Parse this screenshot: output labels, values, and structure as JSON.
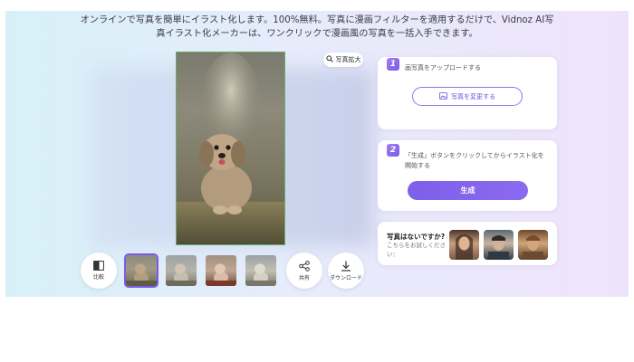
{
  "description": "オンラインで写真を簡単にイラスト化します。100%無料。写真に漫画フィルターを適用するだけで、Vidnoz AI写真イラスト化メーカーは、ワンクリックで漫画風の写真を一括入手できます。",
  "preview": {
    "zoom_label": "写真拡大",
    "zoom_icon": "search-icon",
    "image_alt": "illustrated puppy sitting in grass"
  },
  "steps": [
    {
      "number": "1",
      "text": "画写真をアップロードする",
      "button_label": "写真を変更する",
      "button_icon": "image-icon"
    },
    {
      "number": "2",
      "text": "「生成」ボタンをクリックしてからイラスト化を開始する",
      "button_label": "生成"
    }
  ],
  "samples": {
    "title": "写真はないですか?",
    "subtitle": "こちらをお試しください：",
    "items": [
      "sample-portrait-woman",
      "sample-portrait-man",
      "sample-portrait-boy"
    ]
  },
  "toolbar": {
    "compare_label": "比較",
    "compare_icon": "compare-icon",
    "share_label": "共有",
    "share_icon": "share-icon",
    "download_label": "ダウンロード",
    "download_icon": "download-icon",
    "thumbnails": [
      "thumb-1",
      "thumb-2",
      "thumb-3",
      "thumb-4"
    ],
    "selected_thumbnail": 0
  },
  "colors": {
    "accent": "#7d5fe9",
    "hero_left": "#d7f0f8",
    "hero_right": "#efe3fb"
  }
}
